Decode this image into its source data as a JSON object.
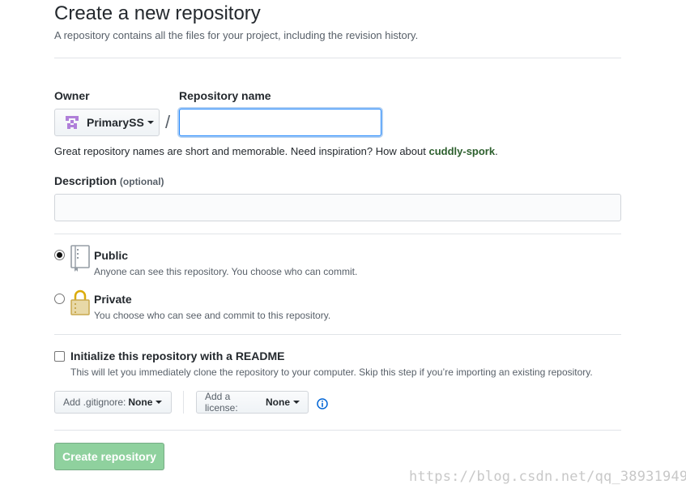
{
  "header": {
    "title": "Create a new repository",
    "subtitle": "A repository contains all the files for your project, including the revision history."
  },
  "owner": {
    "label": "Owner",
    "value": "PrimarySS"
  },
  "repo_name": {
    "label": "Repository name",
    "value": "",
    "slash": "/"
  },
  "hint": {
    "text": "Great repository names are short and memorable. Need inspiration? How about ",
    "suggestion": "cuddly-spork",
    "end": "."
  },
  "description": {
    "label": "Description",
    "optional": "(optional)",
    "value": ""
  },
  "visibility": {
    "public": {
      "title": "Public",
      "desc": "Anyone can see this repository. You choose who can commit.",
      "selected": true
    },
    "private": {
      "title": "Private",
      "desc": "You choose who can see and commit to this repository.",
      "selected": false
    }
  },
  "readme": {
    "title": "Initialize this repository with a README",
    "desc": "This will let you immediately clone the repository to your computer. Skip this step if you’re importing an existing repository.",
    "checked": false
  },
  "gitignore": {
    "label": "Add .gitignore:",
    "value": "None"
  },
  "license": {
    "label": "Add a license:",
    "value": "None"
  },
  "create_button": "Create repository",
  "watermark": "https://blog.csdn.net/qq_38931949",
  "colors": {
    "accent": "#2188ff",
    "create_button_bg": "#8fd19e",
    "suggestion": "#2c5f2d",
    "info_icon": "#0366d6"
  },
  "icons": {
    "owner_avatar": "identicon-avatar",
    "public": "repo-book-icon",
    "private": "lock-icon",
    "info": "info-icon"
  }
}
